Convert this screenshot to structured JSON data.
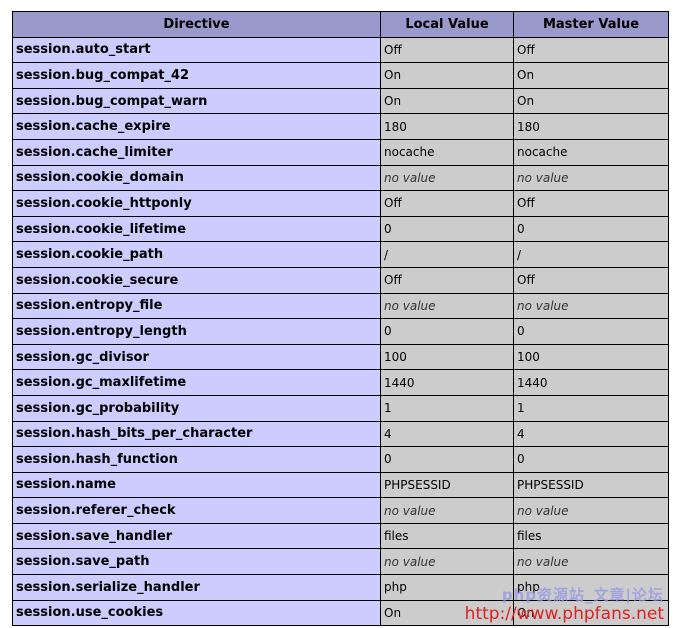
{
  "table": {
    "headers": {
      "directive": "Directive",
      "local": "Local Value",
      "master": "Master Value"
    },
    "rows": [
      {
        "directive": "session.auto_start",
        "local": "Off",
        "master": "Off",
        "no_value": false
      },
      {
        "directive": "session.bug_compat_42",
        "local": "On",
        "master": "On",
        "no_value": false
      },
      {
        "directive": "session.bug_compat_warn",
        "local": "On",
        "master": "On",
        "no_value": false
      },
      {
        "directive": "session.cache_expire",
        "local": "180",
        "master": "180",
        "no_value": false
      },
      {
        "directive": "session.cache_limiter",
        "local": "nocache",
        "master": "nocache",
        "no_value": false
      },
      {
        "directive": "session.cookie_domain",
        "local": "no value",
        "master": "no value",
        "no_value": true
      },
      {
        "directive": "session.cookie_httponly",
        "local": "Off",
        "master": "Off",
        "no_value": false
      },
      {
        "directive": "session.cookie_lifetime",
        "local": "0",
        "master": "0",
        "no_value": false
      },
      {
        "directive": "session.cookie_path",
        "local": "/",
        "master": "/",
        "no_value": false
      },
      {
        "directive": "session.cookie_secure",
        "local": "Off",
        "master": "Off",
        "no_value": false
      },
      {
        "directive": "session.entropy_file",
        "local": "no value",
        "master": "no value",
        "no_value": true
      },
      {
        "directive": "session.entropy_length",
        "local": "0",
        "master": "0",
        "no_value": false
      },
      {
        "directive": "session.gc_divisor",
        "local": "100",
        "master": "100",
        "no_value": false
      },
      {
        "directive": "session.gc_maxlifetime",
        "local": "1440",
        "master": "1440",
        "no_value": false
      },
      {
        "directive": "session.gc_probability",
        "local": "1",
        "master": "1",
        "no_value": false
      },
      {
        "directive": "session.hash_bits_per_character",
        "local": "4",
        "master": "4",
        "no_value": false
      },
      {
        "directive": "session.hash_function",
        "local": "0",
        "master": "0",
        "no_value": false
      },
      {
        "directive": "session.name",
        "local": "PHPSESSID",
        "master": "PHPSESSID",
        "no_value": false
      },
      {
        "directive": "session.referer_check",
        "local": "no value",
        "master": "no value",
        "no_value": true
      },
      {
        "directive": "session.save_handler",
        "local": "files",
        "master": "files",
        "no_value": false
      },
      {
        "directive": "session.save_path",
        "local": "no value",
        "master": "no value",
        "no_value": true
      },
      {
        "directive": "session.serialize_handler",
        "local": "php",
        "master": "php",
        "no_value": false
      },
      {
        "directive": "session.use_cookies",
        "local": "On",
        "master": "On",
        "no_value": false
      }
    ]
  },
  "watermark": {
    "line1": "php资源站_文章|论坛",
    "url": "http://www.phpfans.net"
  },
  "colors": {
    "header_bg": "#9999cc",
    "directive_bg": "#ccccff",
    "value_bg": "#cccccc",
    "border": "#000000",
    "watermark_url": "#dd2222"
  }
}
